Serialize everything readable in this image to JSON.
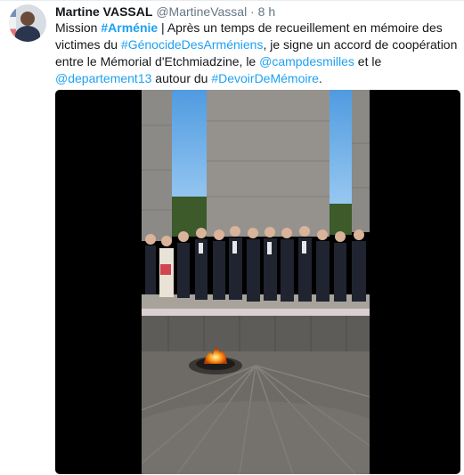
{
  "tweet": {
    "author_name": "Martine VASSAL",
    "author_handle": "@MartineVassal",
    "separator": "·",
    "time": "8 h",
    "text_parts": [
      {
        "t": "Mission ",
        "k": "plain"
      },
      {
        "t": "#Arménie",
        "k": "tagbold"
      },
      {
        "t": " | Après un temps de recueillement en mémoire des victimes du ",
        "k": "plain"
      },
      {
        "t": "#GénocideDesArméniens",
        "k": "tag"
      },
      {
        "t": ", je signe un accord de coopération entre le Mémorial d'Etchmiadzine, le ",
        "k": "plain"
      },
      {
        "t": "@campdesmilles",
        "k": "mention"
      },
      {
        "t": " et le ",
        "k": "plain"
      },
      {
        "t": "@departement13",
        "k": "mention"
      },
      {
        "t": " autour du ",
        "k": "plain"
      },
      {
        "t": "#DevoirDeMémoire",
        "k": "tag"
      },
      {
        "t": ".",
        "k": "plain"
      }
    ]
  },
  "colors": {
    "link": "#1da1f2",
    "muted": "#657786",
    "text": "#14171a"
  },
  "media": {
    "type": "video",
    "icon": "video-icon"
  }
}
